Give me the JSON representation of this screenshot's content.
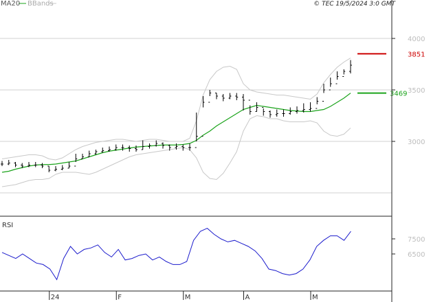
{
  "header": {
    "legend_ma": "MA20",
    "legend_bb": "BBands",
    "stamp": "© TEC 19/5/2024 3:0 GMT"
  },
  "colors": {
    "ma": "#1aa31a",
    "bands": "#c8c8c8",
    "price": "#000000",
    "rsi": "#1a1acc",
    "resistance": "#cc0000",
    "grid": "#d0d0d0",
    "axis": "#222222"
  },
  "chart_data": [
    {
      "type": "line",
      "title": "",
      "ylim": [
        2500,
        4150
      ],
      "yticks": [
        3000,
        3500,
        4000
      ],
      "x_labels": [
        {
          "label": "24",
          "index": 7
        },
        {
          "label": "F",
          "index": 17
        },
        {
          "label": "M",
          "index": 27
        },
        {
          "label": "A",
          "index": 36
        },
        {
          "label": "M",
          "index": 46
        }
      ],
      "levels": [
        {
          "name": "resistance",
          "label": "3851",
          "value": 3851,
          "from_index": 52,
          "to_index": 56
        },
        {
          "name": "ma-last",
          "label": "3469",
          "value": 3469,
          "from_index": 52,
          "to_index": 56
        }
      ],
      "series": [
        {
          "name": "",
          "kind": "price",
          "values": [
            2780,
            2790,
            2770,
            2760,
            2770,
            2770,
            2760,
            2720,
            2730,
            2740,
            2760,
            2830,
            2850,
            2880,
            2900,
            2910,
            2920,
            2940,
            2940,
            2930,
            2920,
            2950,
            2960,
            2980,
            2960,
            2940,
            2950,
            2940,
            2940,
            3050,
            3380,
            3470,
            3440,
            3420,
            3440,
            3430,
            3400,
            3290,
            3330,
            3290,
            3260,
            3270,
            3270,
            3290,
            3300,
            3310,
            3320,
            3390,
            3500,
            3560,
            3630,
            3680,
            3740
          ],
          "highs": [
            2810,
            2820,
            2800,
            2790,
            2800,
            2800,
            2790,
            2760,
            2760,
            2770,
            2800,
            2880,
            2880,
            2910,
            2920,
            2940,
            2950,
            2970,
            2970,
            2960,
            2960,
            3010,
            2980,
            3010,
            2990,
            2970,
            2980,
            2970,
            2980,
            3280,
            3440,
            3500,
            3470,
            3460,
            3470,
            3470,
            3460,
            3350,
            3380,
            3320,
            3300,
            3310,
            3310,
            3330,
            3340,
            3370,
            3380,
            3430,
            3560,
            3620,
            3680,
            3700,
            3790
          ],
          "lows": [
            2760,
            2770,
            2750,
            2740,
            2750,
            2750,
            2740,
            2700,
            2710,
            2720,
            2740,
            2800,
            2830,
            2850,
            2870,
            2890,
            2900,
            2910,
            2910,
            2900,
            2900,
            2920,
            2930,
            2950,
            2930,
            2910,
            2920,
            2910,
            2910,
            3000,
            3330,
            3440,
            3410,
            3390,
            3410,
            3400,
            3300,
            3260,
            3290,
            3250,
            3230,
            3240,
            3240,
            3260,
            3270,
            3280,
            3290,
            3360,
            3470,
            3530,
            3600,
            3650,
            3660
          ]
        },
        {
          "name": "MA20",
          "kind": "ma",
          "values": [
            2700,
            2710,
            2730,
            2745,
            2760,
            2770,
            2775,
            2775,
            2780,
            2790,
            2800,
            2810,
            2830,
            2850,
            2870,
            2890,
            2905,
            2915,
            2925,
            2935,
            2945,
            2950,
            2955,
            2960,
            2965,
            2965,
            2965,
            2970,
            2980,
            3010,
            3060,
            3100,
            3150,
            3190,
            3230,
            3270,
            3310,
            3330,
            3350,
            3340,
            3330,
            3320,
            3310,
            3300,
            3295,
            3290,
            3290,
            3300,
            3310,
            3340,
            3380,
            3420,
            3469
          ]
        },
        {
          "name": "BBands",
          "kind": "band-upper",
          "values": [
            2830,
            2840,
            2850,
            2860,
            2870,
            2870,
            2860,
            2830,
            2820,
            2840,
            2880,
            2920,
            2950,
            2970,
            2990,
            3000,
            3010,
            3020,
            3020,
            3010,
            3000,
            3010,
            3020,
            3020,
            3010,
            3000,
            3000,
            3000,
            3030,
            3200,
            3450,
            3600,
            3680,
            3720,
            3730,
            3700,
            3560,
            3500,
            3480,
            3470,
            3460,
            3450,
            3450,
            3440,
            3430,
            3420,
            3410,
            3460,
            3570,
            3650,
            3720,
            3770,
            3810
          ]
        },
        {
          "name": "BBands",
          "kind": "band-lower",
          "values": [
            2560,
            2570,
            2580,
            2600,
            2620,
            2630,
            2630,
            2640,
            2680,
            2700,
            2700,
            2700,
            2690,
            2680,
            2700,
            2730,
            2760,
            2790,
            2820,
            2850,
            2870,
            2880,
            2890,
            2900,
            2910,
            2920,
            2930,
            2940,
            2920,
            2840,
            2700,
            2640,
            2630,
            2690,
            2790,
            2900,
            3100,
            3220,
            3250,
            3240,
            3220,
            3220,
            3200,
            3190,
            3190,
            3190,
            3200,
            3180,
            3100,
            3060,
            3050,
            3070,
            3130
          ]
        }
      ]
    },
    {
      "type": "line",
      "title": "RSI",
      "ylim": [
        40,
        90
      ],
      "yticks": [
        65,
        75
      ],
      "series": [
        {
          "name": "",
          "values": [
            66,
            64,
            62,
            65,
            62,
            59,
            58,
            55,
            48,
            62,
            70,
            65,
            68,
            69,
            71,
            66,
            63,
            68,
            61,
            62,
            64,
            65,
            61,
            63,
            60,
            58,
            58,
            60,
            74,
            80,
            82,
            78,
            75,
            73,
            74,
            72,
            70,
            67,
            62,
            55,
            54,
            52,
            51,
            52,
            55,
            61,
            70,
            74,
            77,
            77,
            74,
            80
          ]
        }
      ]
    }
  ]
}
